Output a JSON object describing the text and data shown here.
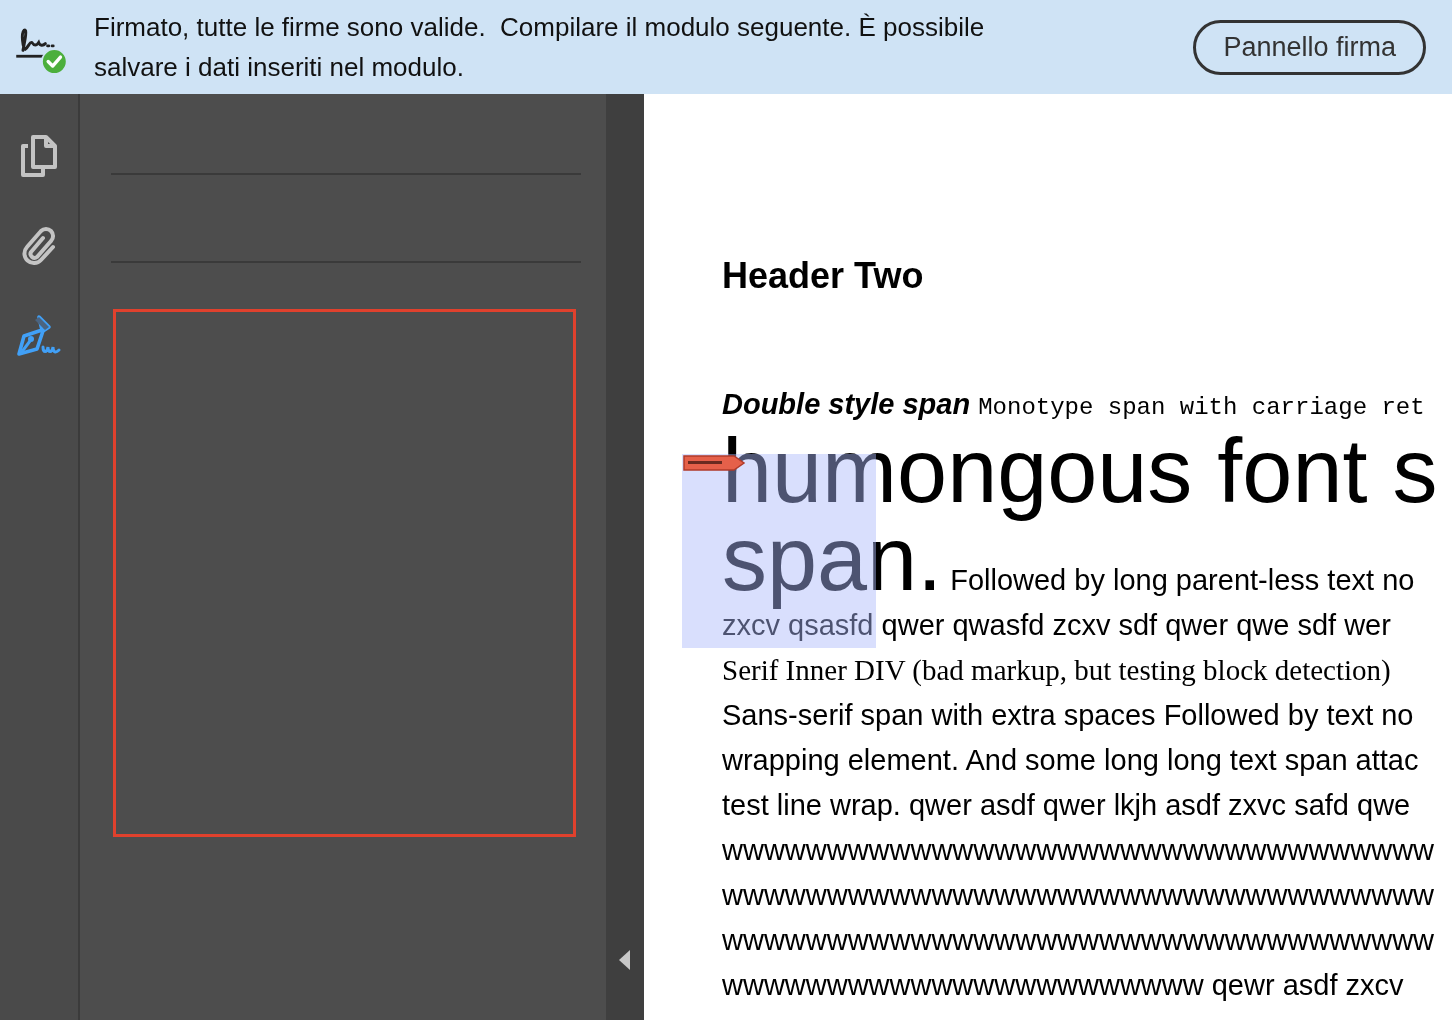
{
  "banner": {
    "message": "Firmato, tutte le firme sono valide.  Compilare il modulo seguente. È possibile salvare i dati inseriti nel modulo.",
    "button": "Pannello firma"
  },
  "toolbar": [
    {
      "kind": "pages",
      "selected": false
    },
    {
      "kind": "attachments",
      "selected": false
    },
    {
      "kind": "signatures",
      "selected": true
    }
  ],
  "document": {
    "heading": "Header Two",
    "lines": [
      [
        {
          "kind": "emphasis",
          "text": "Double style span"
        },
        {
          "kind": "monospace",
          "text": "Monotype span with carriage ret"
        }
      ],
      [
        {
          "kind": "large",
          "text": "humongous font s"
        }
      ],
      [
        {
          "kind": "large",
          "text": "span."
        },
        {
          "kind": "body",
          "text": "Followed by long parent-less text no"
        }
      ],
      [
        {
          "kind": "body",
          "text": "zxcv qsasfd qwer qwasfd zcxv sdf qwer qwe sdf wer"
        }
      ],
      [
        {
          "kind": "serif",
          "text": "Serif Inner DIV (bad markup, but testing block detection)"
        }
      ],
      [
        {
          "kind": "body",
          "text": "Sans-serif span with extra spaces Followed by text no"
        }
      ],
      [
        {
          "kind": "body",
          "text": "wrapping element. And some long long text span attac"
        }
      ],
      [
        {
          "kind": "body",
          "text": "test line wrap. qwer asdf qwer lkjh asdf zxvc safd qwe"
        }
      ],
      [
        {
          "kind": "body",
          "text": "wwwwwwwwwwwwwwwwwwwwwwwwwwwwwwwwww"
        }
      ],
      [
        {
          "kind": "body",
          "text": "wwwwwwwwwwwwwwwwwwwwwwwwwwwwwwwwww"
        }
      ],
      [
        {
          "kind": "body",
          "text": "wwwwwwwwwwwwwwwwwwwwwwwwwwwwwwwwww"
        }
      ],
      [
        {
          "kind": "body",
          "text": "wwwwwwwwwwwwwwwwwwwwwww qewr asdf zxcv"
        }
      ]
    ]
  }
}
